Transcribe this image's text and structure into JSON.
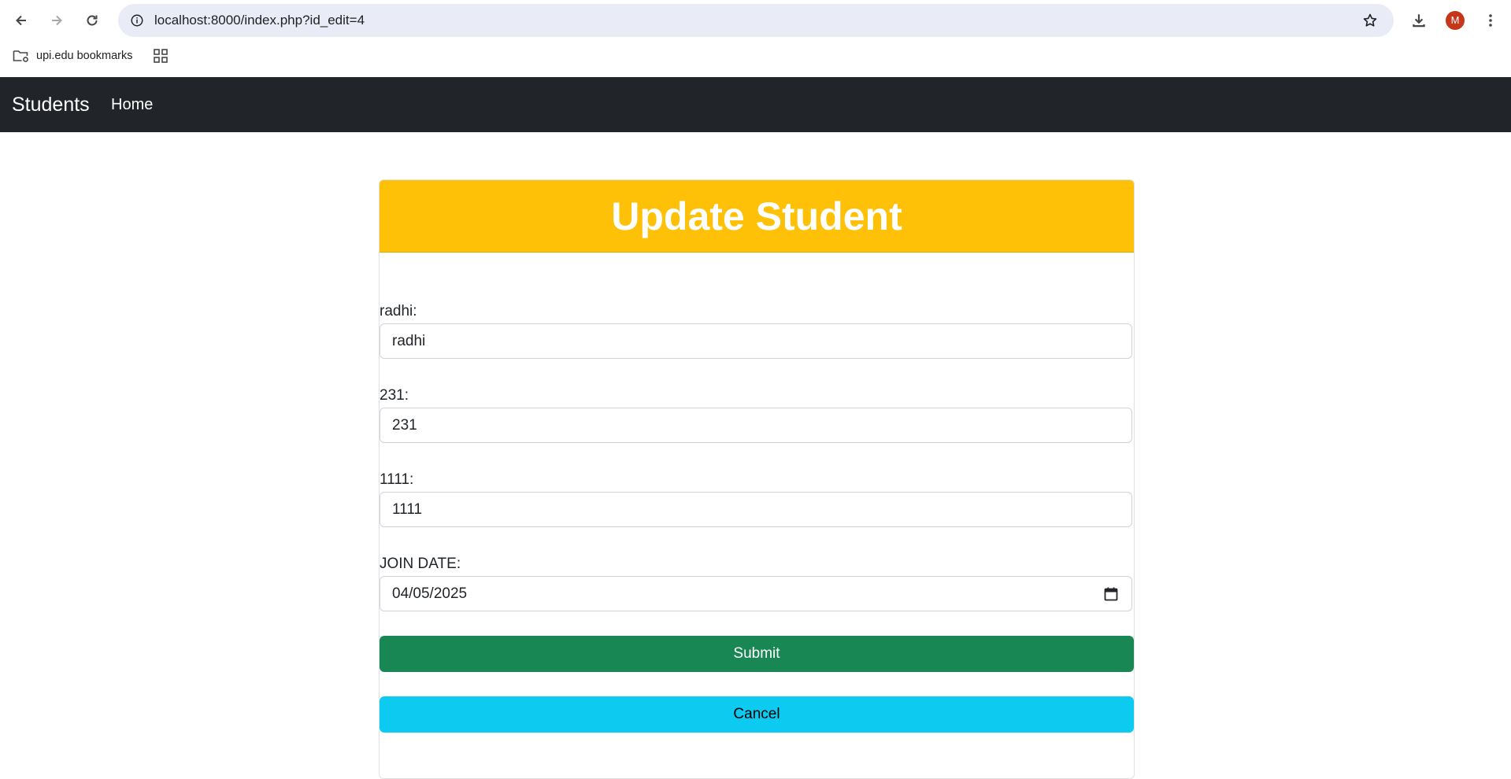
{
  "browser": {
    "url": "localhost:8000/index.php?id_edit=4",
    "bookmarks": [
      {
        "label": "upi.edu bookmarks"
      }
    ],
    "profile_initial": "M"
  },
  "navbar": {
    "brand": "Students",
    "links": [
      {
        "label": "Home"
      }
    ]
  },
  "card": {
    "title": "Update Student",
    "header_color": "#ffc107",
    "fields": [
      {
        "label": "radhi:",
        "value": "radhi"
      },
      {
        "label": "231:",
        "value": "231"
      },
      {
        "label": "1111:",
        "value": "1111"
      },
      {
        "label": "JOIN DATE:",
        "value": "04/05/2025",
        "icon": "calendar-icon"
      }
    ],
    "submit_label": "Submit",
    "submit_color": "#198754",
    "cancel_label": "Cancel",
    "cancel_color": "#0dcaf0"
  }
}
